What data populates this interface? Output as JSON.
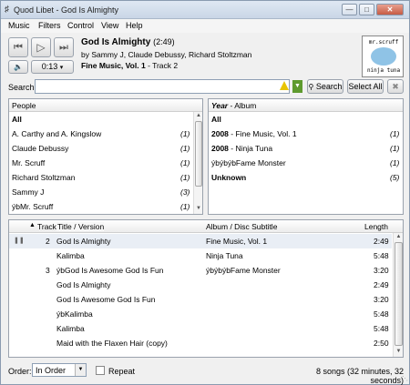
{
  "window": {
    "title": "Quod Libet - God Is Almighty",
    "min": "—",
    "max": "□",
    "close": "✕"
  },
  "menu": {
    "music": "Music",
    "filters": "Filters",
    "control": "Control",
    "view": "View",
    "help": "Help"
  },
  "controls": {
    "prev": "⏮",
    "play": "▷",
    "next": "⏭",
    "volume": "🔈",
    "position": "0:13",
    "position_arrow": "▾"
  },
  "now_playing": {
    "title": "God Is Almighty",
    "length": "(2:49)",
    "by": "by Sammy J, Claude Debussy, Richard Stoltzman",
    "album": "Fine Music, Vol. 1",
    "track": " - Track 2",
    "cover_top": "mr.scruff",
    "cover_bottom": "ninja tuna"
  },
  "search": {
    "label": "Search:",
    "value": "",
    "search_button": "Search",
    "select_all_button": "Select All"
  },
  "people_pane": {
    "header": "People",
    "items": [
      {
        "name": "All",
        "count": ""
      },
      {
        "name": "A. Carthy and A. Kingslow",
        "count": "(1)"
      },
      {
        "name": "Claude Debussy",
        "count": "(1)"
      },
      {
        "name": "Mr. Scruff",
        "count": "(1)"
      },
      {
        "name": "Richard Stoltzman",
        "count": "(1)"
      },
      {
        "name": "Sammy J",
        "count": "(3)"
      },
      {
        "name": "ýbMr. Scruff",
        "count": "(1)"
      }
    ]
  },
  "album_pane": {
    "header_year": "Year",
    "header_album": " - Album",
    "items": [
      {
        "year": "",
        "name": "All",
        "count": ""
      },
      {
        "year": "2008",
        "name": " - Fine Music, Vol. 1",
        "count": "(1)"
      },
      {
        "year": "2008",
        "name": " - Ninja Tuna",
        "count": "(1)"
      },
      {
        "year": "",
        "name": "ýbýbýbFame Monster",
        "count": "(1)"
      },
      {
        "year": "",
        "name": "Unknown",
        "count": "(5)"
      }
    ]
  },
  "songlist": {
    "columns": {
      "track": "Track",
      "title": "Title / Version",
      "album": "Album / Disc Subtitle",
      "length": "Length"
    },
    "rows": [
      {
        "track": "2",
        "title": "God Is Almighty",
        "album": "Fine Music, Vol. 1",
        "length": "2:49"
      },
      {
        "track": "",
        "title": "Kalimba",
        "album": "Ninja Tuna",
        "length": "5:48"
      },
      {
        "track": "3",
        "title": "ýbGod Is Awesome God Is Fun",
        "album": "ýbýbýbFame Monster",
        "length": "3:20"
      },
      {
        "track": "",
        "title": "God Is Almighty",
        "album": "",
        "length": "2:49"
      },
      {
        "track": "",
        "title": "God Is Awesome God Is Fun",
        "album": "",
        "length": "3:20"
      },
      {
        "track": "",
        "title": "ýbKalimba",
        "album": "",
        "length": "5:48"
      },
      {
        "track": "",
        "title": "Kalimba",
        "album": "",
        "length": "5:48"
      },
      {
        "track": "",
        "title": "Maid with the Flaxen Hair (copy)",
        "album": "",
        "length": "2:50"
      }
    ]
  },
  "footer": {
    "order_label": "Order:",
    "order_value": "In Order",
    "repeat_label": "Repeat",
    "status": "8 songs (32 minutes, 32 seconds)"
  }
}
